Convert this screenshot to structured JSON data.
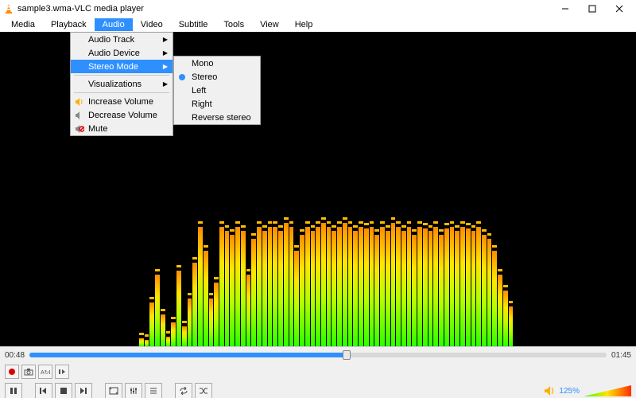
{
  "window": {
    "filename": "sample3.wma",
    "app_name": "VLC media player",
    "title_sep": " - "
  },
  "menubar": [
    "Media",
    "Playback",
    "Audio",
    "Video",
    "Subtitle",
    "Tools",
    "View",
    "Help"
  ],
  "audio_menu": {
    "audio_track": "Audio Track",
    "audio_device": "Audio Device",
    "stereo_mode": "Stereo Mode",
    "visualizations": "Visualizations",
    "increase_volume": "Increase Volume",
    "decrease_volume": "Decrease Volume",
    "mute": "Mute"
  },
  "stereo_menu": {
    "mono": "Mono",
    "stereo": "Stereo",
    "left": "Left",
    "right": "Right",
    "reverse": "Reverse stereo"
  },
  "playback": {
    "elapsed": "00:48",
    "total": "01:45",
    "progress_pct": 55
  },
  "volume": {
    "percent_label": "125%"
  },
  "viz_bars": [
    10,
    8,
    55,
    90,
    40,
    12,
    30,
    95,
    25,
    60,
    105,
    150,
    120,
    60,
    80,
    150,
    145,
    140,
    150,
    145,
    90,
    135,
    150,
    145,
    150,
    150,
    145,
    155,
    150,
    120,
    140,
    150,
    145,
    150,
    155,
    150,
    145,
    150,
    155,
    150,
    145,
    150,
    148,
    150,
    140,
    150,
    145,
    155,
    150,
    145,
    150,
    140,
    150,
    148,
    145,
    150,
    140,
    148,
    150,
    145,
    150,
    148,
    145,
    150,
    140,
    135,
    120,
    90,
    70,
    50
  ]
}
